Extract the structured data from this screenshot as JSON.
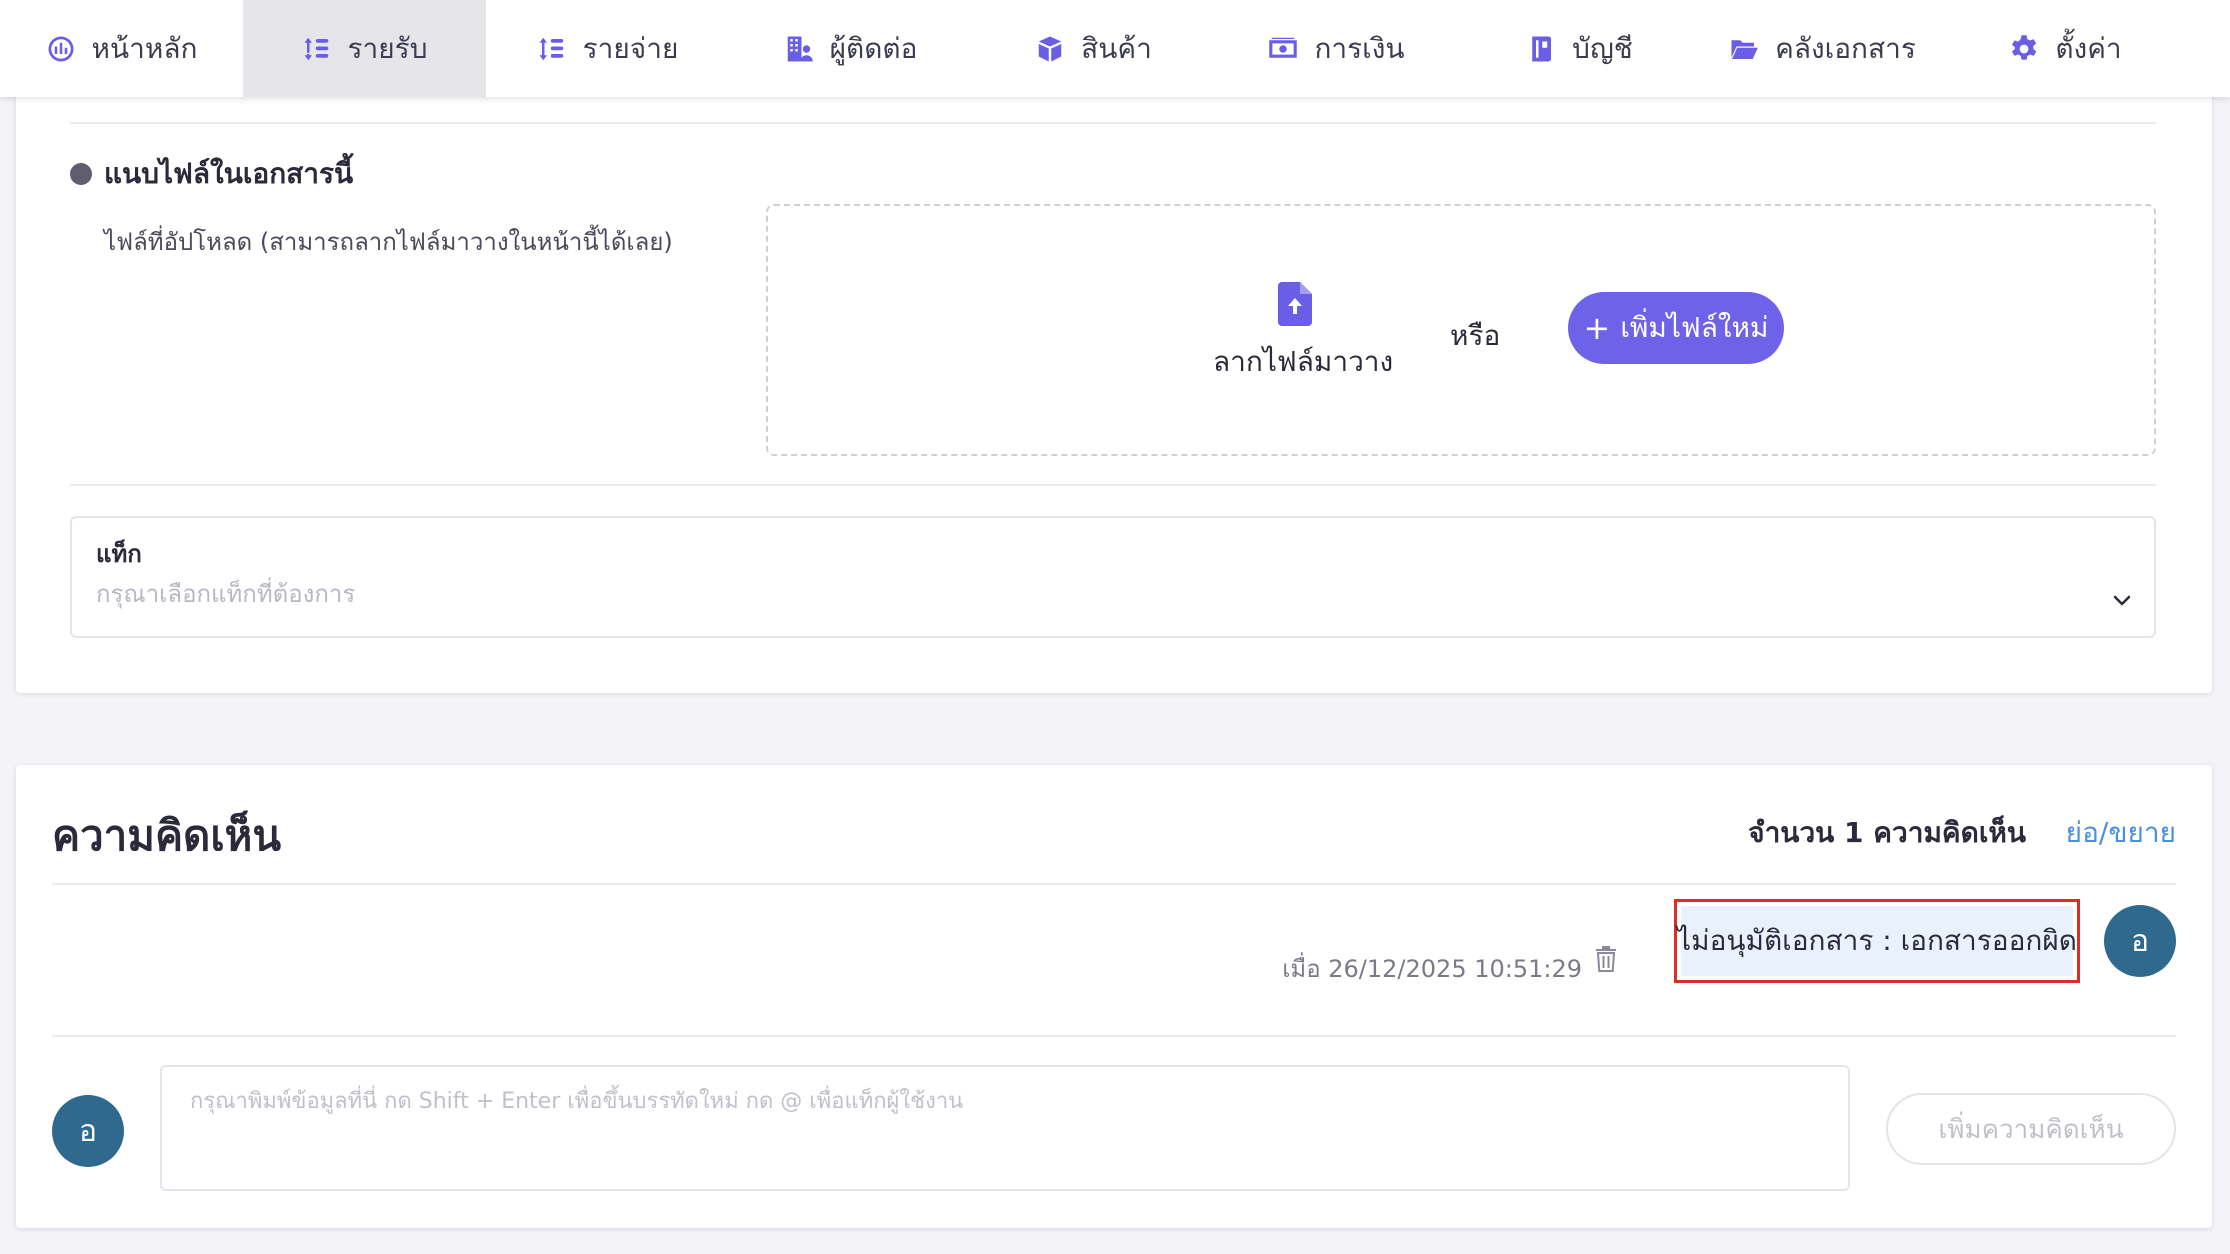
{
  "nav": {
    "items": [
      {
        "label": "หน้าหลัก",
        "icon": "dashboard-gauge-icon"
      },
      {
        "label": "รายรับ",
        "icon": "income-sort-icon"
      },
      {
        "label": "รายจ่าย",
        "icon": "expense-sort-icon"
      },
      {
        "label": "ผู้ติดต่อ",
        "icon": "contacts-building-icon"
      },
      {
        "label": "สินค้า",
        "icon": "product-box-icon"
      },
      {
        "label": "การเงิน",
        "icon": "money-bill-icon"
      },
      {
        "label": "บัญชี",
        "icon": "accounting-book-icon"
      },
      {
        "label": "คลังเอกสาร",
        "icon": "folder-open-icon"
      },
      {
        "label": "ตั้งค่า",
        "icon": "settings-gear-icon"
      }
    ],
    "active_index": 1,
    "accent_color": "#6a5ee6"
  },
  "attachments": {
    "title": "แนบไฟล์ในเอกสารนี้",
    "upload_label": "ไฟล์ที่อัปโหลด (สามารถลากไฟล์มาวางในหน้านี้ได้เลย)",
    "drop_text": "ลากไฟล์มาวาง",
    "or_text": "หรือ",
    "add_file_label": "เพิ่มไฟล์ใหม่",
    "button_color": "#6e63e8"
  },
  "tag": {
    "label": "แท็ก",
    "placeholder": "กรุณาเลือกแท็กที่ต้องการ"
  },
  "comments": {
    "title": "ความคิดเห็น",
    "count_label": "จำนวน 1 ความคิดเห็น",
    "collapse_label": "ย่อ/ขยาย",
    "items": [
      {
        "time": "เมื่อ 26/12/2025 10:51:29",
        "text": "ไม่อนุมัติเอกสาร : เอกสารออกผิด",
        "avatar": "อ"
      }
    ],
    "input_avatar": "อ",
    "input_placeholder": "กรุณาพิมพ์ข้อมูลที่นี่ กด Shift + Enter เพื่อขึ้นบรรทัดใหม่ กด @ เพื่อแท็กผู้ใช้งาน",
    "add_comment_label": "เพิ่มความคิดเห็น",
    "highlight_color": "#d93025",
    "avatar_color": "#2f6a8e"
  }
}
